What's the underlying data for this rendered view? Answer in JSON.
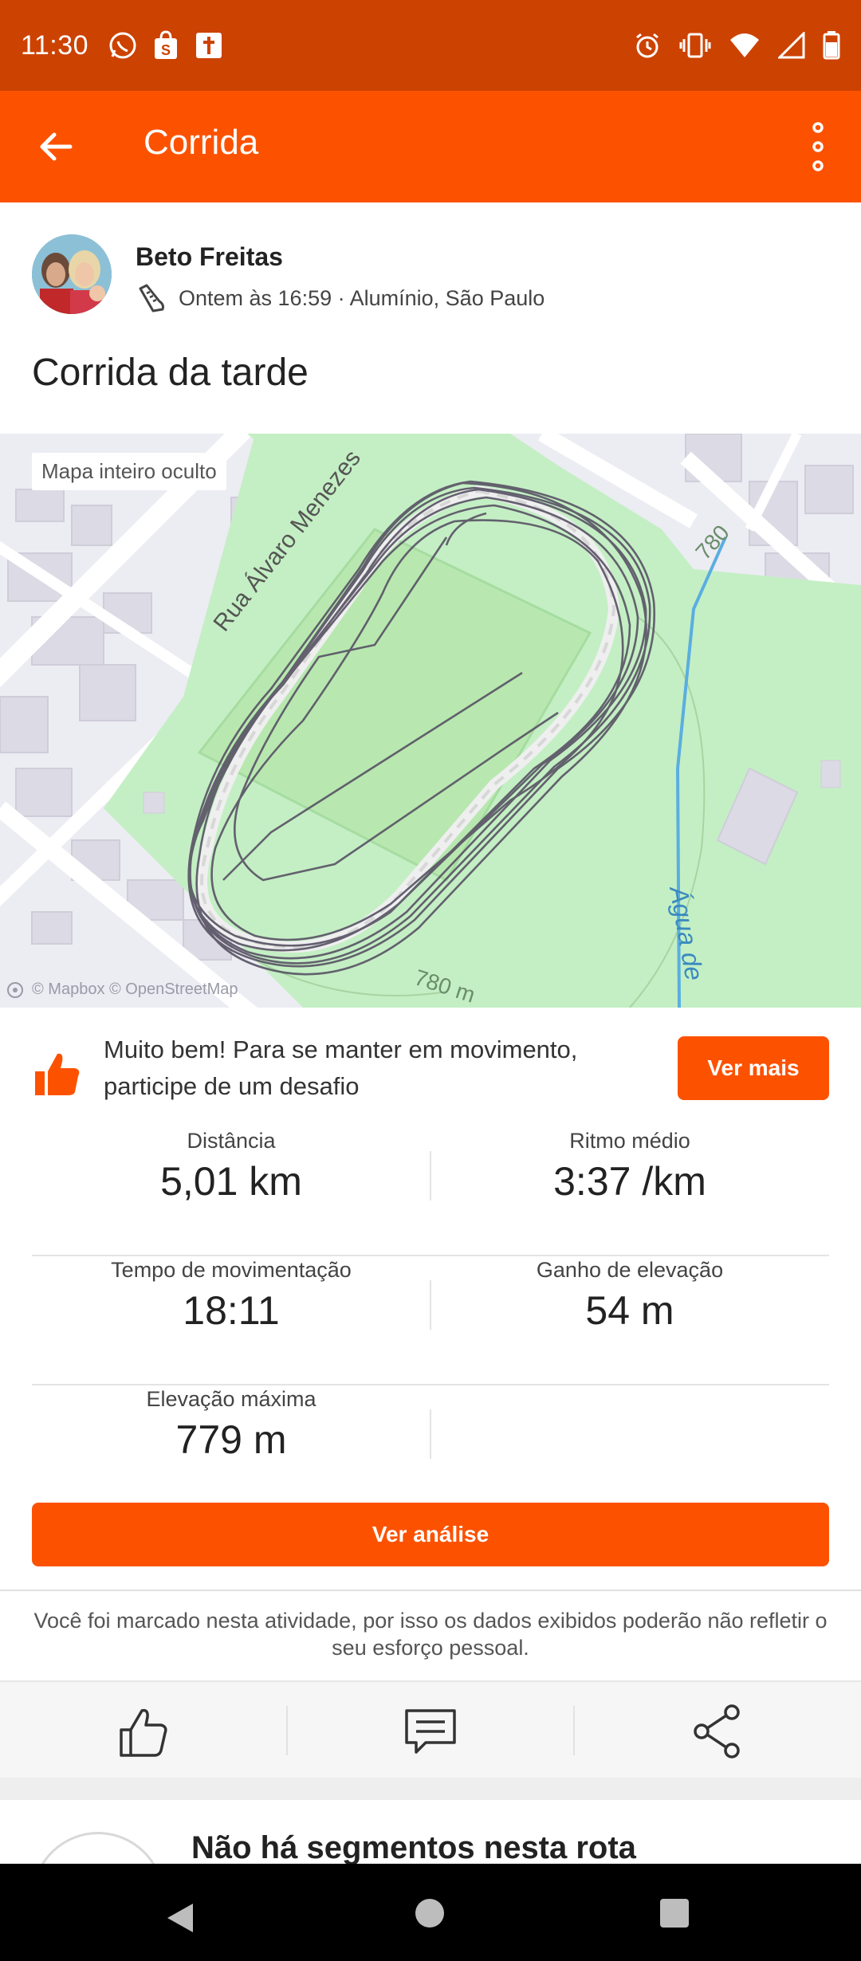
{
  "status_bar": {
    "time": "11:30",
    "left_icons": [
      "whatsapp-icon",
      "shopee-icon",
      "bible-icon"
    ],
    "right_icons": [
      "alarm-icon",
      "vibrate-icon",
      "wifi-icon",
      "signal-icon",
      "battery-icon"
    ]
  },
  "app_bar": {
    "title": "Corrida",
    "back_icon": "arrow-left-icon",
    "menu_icon": "more-vertical-icon"
  },
  "athlete": {
    "name": "Beto Freitas",
    "meta": "Ontem às 16:59 · Alumínio, São Paulo",
    "activity_icon": "shoe-icon"
  },
  "activity_title": "Corrida da tarde",
  "map": {
    "chip": "Mapa inteiro oculto",
    "street_label": "Rua Álvaro Menezes",
    "stream_label": "Água de",
    "contour_label_1": "780",
    "contour_label_2": "780 m",
    "attribution": "© Mapbox © OpenStreetMap",
    "colors": {
      "park": "#c4efc4",
      "route": "#5a5566",
      "stream": "#5aaee0"
    }
  },
  "challenge": {
    "message": "Muito bem! Para se manter em movimento, participe de um desafio",
    "button": "Ver mais"
  },
  "stats": [
    {
      "label": "Distância",
      "value": "5,01 km"
    },
    {
      "label": "Ritmo médio",
      "value": "3:37 /km"
    },
    {
      "label": "Tempo de movimentação",
      "value": "18:11"
    },
    {
      "label": "Ganho de elevação",
      "value": "54 m"
    },
    {
      "label": "Elevação máxima",
      "value": "779 m"
    }
  ],
  "analysis_button": "Ver análise",
  "tag_note": "Você foi marcado nesta atividade, por isso os dados exibidos poderão não refletir o seu esforço pessoal.",
  "actions": [
    "like-icon",
    "comment-icon",
    "share-icon"
  ],
  "segments": {
    "title": "Não há segmentos nesta rota"
  },
  "accent_color": "#FC5200"
}
